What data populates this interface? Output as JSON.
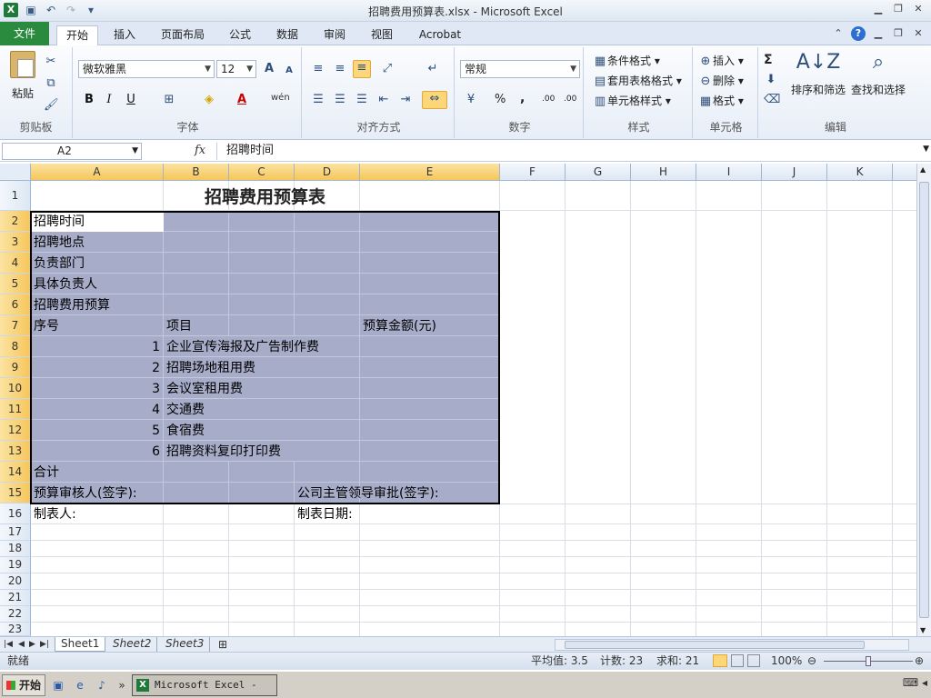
{
  "window": {
    "title": "招聘费用预算表.xlsx  -  Microsoft Excel"
  },
  "tabs": {
    "file": "文件",
    "home": "开始",
    "insert": "插入",
    "layout": "页面布局",
    "formulas": "公式",
    "data": "数据",
    "review": "审阅",
    "view": "视图",
    "acrobat": "Acrobat"
  },
  "ribbon": {
    "clipboard": {
      "paste": "粘贴",
      "label": "剪贴板"
    },
    "font": {
      "name": "微软雅黑",
      "size": "12",
      "label": "字体",
      "bold": "B",
      "italic": "I",
      "underline": "U",
      "grow": "A",
      "shrink": "A",
      "color_glyph": "A",
      "phonetic": "wén"
    },
    "alignment": {
      "label": "对齐方式"
    },
    "number": {
      "format": "常规",
      "label": "数字",
      "percent": "%",
      "comma": ",",
      "inc_dec": ".00",
      "dec_dec": ".00"
    },
    "styles": {
      "conditional": "条件格式",
      "table": "套用表格格式",
      "cell": "单元格样式",
      "label": "样式"
    },
    "cells": {
      "insert": "插入",
      "delete": "删除",
      "format": "格式",
      "label": "单元格"
    },
    "editing": {
      "sum": "Σ",
      "sort": "排序和筛选",
      "find": "查找和选择",
      "label": "编辑"
    }
  },
  "formula_bar": {
    "name_box": "A2",
    "fx": "fx",
    "content": "招聘时间"
  },
  "columns": [
    "A",
    "B",
    "C",
    "D",
    "E",
    "F",
    "G",
    "H",
    "I",
    "J",
    "K"
  ],
  "rows": [
    "1",
    "2",
    "3",
    "4",
    "5",
    "6",
    "7",
    "8",
    "9",
    "10",
    "11",
    "12",
    "13",
    "14",
    "15",
    "16",
    "17",
    "18",
    "19",
    "20",
    "21",
    "22",
    "23"
  ],
  "sheet": {
    "title": "招聘费用预算表",
    "r2": "招聘时间",
    "r3": "招聘地点",
    "r4": "负责部门",
    "r5": "具体负责人",
    "r6": "招聘费用预算",
    "r7_a": "序号",
    "r7_b": "项目",
    "r7_e": "预算金额(元)",
    "items": [
      {
        "no": "1",
        "name": "企业宣传海报及广告制作费"
      },
      {
        "no": "2",
        "name": "招聘场地租用费"
      },
      {
        "no": "3",
        "name": "会议室租用费"
      },
      {
        "no": "4",
        "name": "交通费"
      },
      {
        "no": "5",
        "name": "食宿费"
      },
      {
        "no": "6",
        "name": "招聘资料复印打印费"
      }
    ],
    "r14": "合计",
    "r15_a": "预算审核人(签字):",
    "r15_d": "公司主管领导审批(签字):",
    "r16_a": "制表人:",
    "r16_d": "制表日期:"
  },
  "sheet_tabs": [
    "Sheet1",
    "Sheet2",
    "Sheet3"
  ],
  "status": {
    "mode": "就绪",
    "average": "平均值: 3.5",
    "count": "计数: 23",
    "sum": "求和: 21",
    "zoom": "100%"
  },
  "taskbar": {
    "start": "开始",
    "task": "Microsoft Excel - ..."
  }
}
